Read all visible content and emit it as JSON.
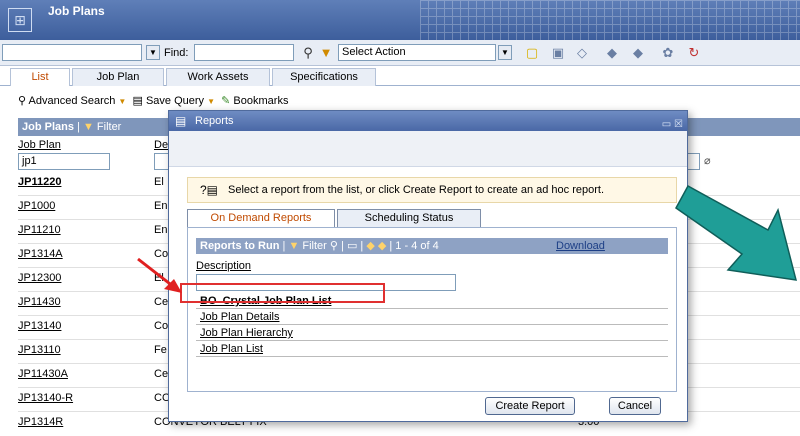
{
  "app": {
    "title": "Job Plans"
  },
  "toolbar": {
    "find_label": "Find:",
    "select_action": "Select Action"
  },
  "tabs": [
    {
      "label": "List"
    },
    {
      "label": "Job Plan"
    },
    {
      "label": "Work Assets"
    },
    {
      "label": "Specifications"
    }
  ],
  "search": {
    "advanced": "Advanced Search",
    "save_query": "Save Query",
    "bookmarks": "Bookmarks"
  },
  "list": {
    "header": "Job Plans",
    "filter": "Filter",
    "col_jobplan": "Job Plan",
    "col_desc": "De",
    "filter_value": "jp1",
    "rows": [
      {
        "jp": "JP11220",
        "desc": "El"
      },
      {
        "jp": "JP1000",
        "desc": "En"
      },
      {
        "jp": "JP11210",
        "desc": "En"
      },
      {
        "jp": "JP1314A",
        "desc": "Co"
      },
      {
        "jp": "JP12300",
        "desc": "El"
      },
      {
        "jp": "JP11430",
        "desc": "Ce"
      },
      {
        "jp": "JP13140",
        "desc": "Co"
      },
      {
        "jp": "JP13110",
        "desc": "Fe"
      },
      {
        "jp": "JP11430A",
        "desc": "Ce"
      },
      {
        "jp": "JP13140-R",
        "desc": "CO"
      },
      {
        "jp": "JP1314R",
        "desc": "CONVEYOR BELT FIX",
        "dur": "3:00"
      }
    ]
  },
  "dialog": {
    "title": "Reports",
    "info": "Select a report from the list, or click Create Report to create an ad hoc report.",
    "tabs": [
      {
        "label": "On Demand Reports"
      },
      {
        "label": "Scheduling Status"
      }
    ],
    "panel": {
      "header": "Reports to Run",
      "filter": "Filter",
      "paging": "1 - 4 of 4",
      "download": "Download",
      "col_desc": "Description",
      "reports": [
        "BO_Crystal Job Plan List",
        "Job Plan Details",
        "Job Plan Hierarchy",
        "Job Plan List"
      ]
    },
    "create_button": "Create Report",
    "cancel_button": "Cancel"
  },
  "colors": {
    "title_bar": "#4a68a6",
    "active_tab": "#c04a00",
    "highlight": "#e03030",
    "teal_arrow": "#1f9e97"
  }
}
